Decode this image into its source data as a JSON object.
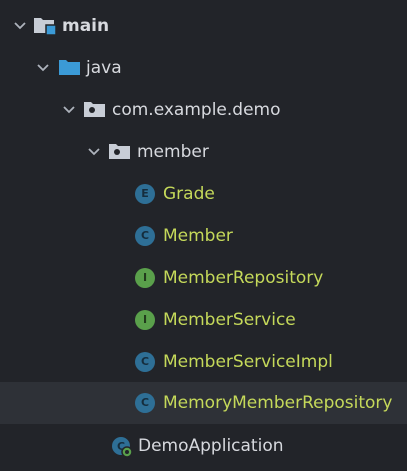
{
  "tree": {
    "rows": [
      {
        "label": "main",
        "type": "source-root",
        "expanded": true
      },
      {
        "label": "java",
        "type": "folder",
        "expanded": true
      },
      {
        "label": "com.example.demo",
        "type": "package",
        "expanded": true
      },
      {
        "label": "member",
        "type": "package",
        "expanded": true
      },
      {
        "label": "Grade",
        "type": "enum",
        "badge": "E"
      },
      {
        "label": "Member",
        "type": "class",
        "badge": "C"
      },
      {
        "label": "MemberRepository",
        "type": "interface",
        "badge": "I"
      },
      {
        "label": "MemberService",
        "type": "interface",
        "badge": "I"
      },
      {
        "label": "MemberServiceImpl",
        "type": "class",
        "badge": "C"
      },
      {
        "label": "MemoryMemberRepository",
        "type": "class",
        "badge": "C",
        "selected": true
      },
      {
        "label": "DemoApplication",
        "type": "spring-application"
      }
    ]
  },
  "colors": {
    "background": "#222429",
    "selected_row": "#2e3137",
    "class_icon": "#2e6f96",
    "interface_icon": "#5aa04b",
    "changed_file_text": "#c5d95a",
    "folder_icon": "#c8cdd6",
    "source_root_marker": "#3b9ad6"
  }
}
